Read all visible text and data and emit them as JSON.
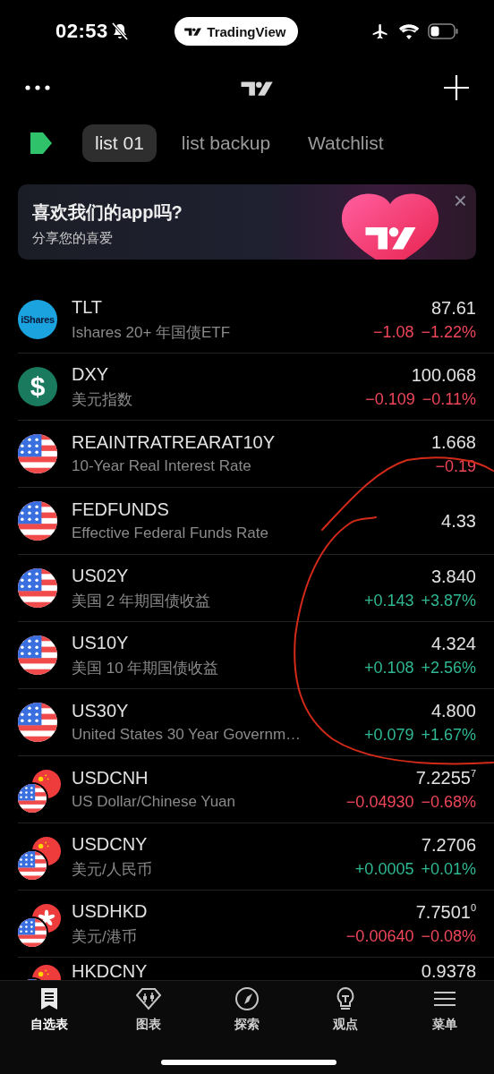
{
  "status_bar": {
    "time": "02:53",
    "app_pill": "TradingView"
  },
  "watchlist_tabs": [
    {
      "label": "list 01",
      "selected": true
    },
    {
      "label": "list backup",
      "selected": false
    },
    {
      "label": "Watchlist",
      "selected": false
    }
  ],
  "banner": {
    "title": "喜欢我们的app吗?",
    "subtitle": "分享您的喜爱",
    "close": "×"
  },
  "rows": [
    {
      "kind": "ishares",
      "logo_text": "iShares",
      "symbol": "TLT",
      "name": "Ishares 20+ 年国债ETF",
      "price": "87.61",
      "change": "−1.08",
      "change_pct": "−1.22%",
      "color": "#f0465a"
    },
    {
      "kind": "dollar",
      "logo_text": "$",
      "symbol": "DXY",
      "name": "美元指数",
      "price": "100.068",
      "change": "−0.109",
      "change_pct": "−0.11%",
      "color": "#f0465a"
    },
    {
      "kind": "us",
      "symbol": "REAINTRATREARAT10Y",
      "name": "10-Year Real Interest Rate",
      "price": "1.668",
      "change_pct": "−0.19",
      "color": "#f0465a"
    },
    {
      "kind": "us",
      "symbol": "FEDFUNDS",
      "name": "Effective Federal Funds Rate",
      "price": "4.33"
    },
    {
      "kind": "us",
      "symbol": "US02Y",
      "name": "美国 2 年期国债收益",
      "price": "3.840",
      "change": "+0.143",
      "change_pct": "+3.87%",
      "color": "#2fb893"
    },
    {
      "kind": "us",
      "symbol": "US10Y",
      "name": "美国 10 年期国债收益",
      "price": "4.324",
      "change": "+0.108",
      "change_pct": "+2.56%",
      "color": "#2fb893"
    },
    {
      "kind": "us",
      "symbol": "US30Y",
      "name": "United States 30 Year Governm…",
      "price": "4.800",
      "change": "+0.079",
      "change_pct": "+1.67%",
      "color": "#2fb893"
    },
    {
      "kind": "pair",
      "symbol": "USDCNH",
      "name": "US Dollar/Chinese Yuan",
      "price": "7.2255$^{7}$",
      "change": "−0.04930",
      "change_pct": "−0.68%",
      "color": "#f0465a"
    },
    {
      "kind": "pair",
      "symbol": "USDCNY",
      "name": "美元/人民币",
      "price": "7.2706",
      "change": "+0.0005",
      "change_pct": "+0.01%",
      "color": "#2fb893"
    },
    {
      "kind": "pair-hk",
      "symbol": "USDHKD",
      "name": "美元/港币",
      "price": "7.7501$^{0}$",
      "change": "−0.00640",
      "change_pct": "−0.08%",
      "color": "#f0465a"
    },
    {
      "kind": "pair",
      "symbol": "HKDCNY",
      "price": "0.9378"
    }
  ],
  "bottom_nav": [
    {
      "label": "自选表",
      "selected": true
    },
    {
      "label": "图表",
      "selected": false
    },
    {
      "label": "探索",
      "selected": false
    },
    {
      "label": "观点",
      "selected": false
    },
    {
      "label": "菜单",
      "selected": false
    }
  ]
}
